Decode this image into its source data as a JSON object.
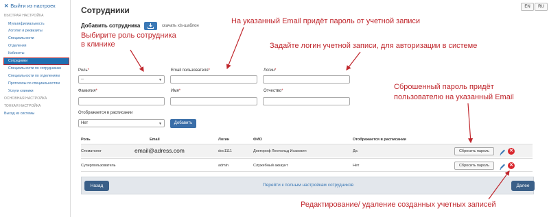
{
  "sidebar": {
    "exit_label": "Выйти из настроек",
    "quick_setup_header": "БЫСТРАЯ НАСТРОЙКА",
    "items": [
      {
        "label": "Мультифилиальность"
      },
      {
        "label": "Логотип и реквизиты"
      },
      {
        "label": "Специальности"
      },
      {
        "label": "Отделения"
      },
      {
        "label": "Кабинеты"
      },
      {
        "label": "Сотрудники"
      },
      {
        "label": "Специальности по сотрудникам"
      },
      {
        "label": "Специальности по отделениям"
      },
      {
        "label": "Протоколы по специальностям"
      },
      {
        "label": "Услуги клиники"
      }
    ],
    "basic_setup": "ОСНОВНАЯ НАСТРОЙКА",
    "fine_setup": "ТОНКАЯ НАСТРОЙКА",
    "exit_system": "Выход из системы"
  },
  "header": {
    "title": "Сотрудники",
    "lang_en": "EN",
    "lang_ru": "RU"
  },
  "add_section": {
    "title": "Добавить сотрудника",
    "download_link": "скачать xls-шаблон"
  },
  "annotations": {
    "email_note": "На указанный Email  придёт   пароль от учетной записи",
    "role_note_line1": "Выбирите роль сотрудника",
    "role_note_line2": "в клинике",
    "login_note": "Задайте логин учетной записи, для авторизации в системе",
    "reset_note_line1": "Сброшенный пароль придёт",
    "reset_note_line2": "пользователю на указанный Email",
    "edit_note": "Редактирование/ удаление созданных учетных записей"
  },
  "form": {
    "role_label": "Роль",
    "role_value": "--",
    "email_label": "Email пользователя",
    "login_label": "Логин",
    "lastname_label": "Фамилия",
    "firstname_label": "Имя",
    "middlename_label": "Отчество",
    "schedule_label": "Отображается в расписании",
    "schedule_value": "Нет",
    "required_mark": "*",
    "add_button": "Добавить"
  },
  "table": {
    "headers": [
      "Роль",
      "Email",
      "Логин",
      "ФИО",
      "Отображается в расписании"
    ],
    "rows": [
      {
        "role": "Стоматолог",
        "email": "email@adress.com",
        "login": "doc1111",
        "fio": "Доктороф Леопольд Исакович",
        "schedule": "Да",
        "reset": "Сбросить пароль"
      },
      {
        "role": "Суперпользователь",
        "email": "",
        "login": "admin",
        "fio": "Служебный аккаунт",
        "schedule": "Нет",
        "reset": "Сбросить пароль"
      }
    ]
  },
  "footer": {
    "back": "Назад",
    "link": "Перейти к полным настройкам сотрудников",
    "next": "Далее"
  },
  "colors": {
    "accent": "#3a78b5",
    "annotation": "#c0272d",
    "delete": "#d9272e"
  }
}
